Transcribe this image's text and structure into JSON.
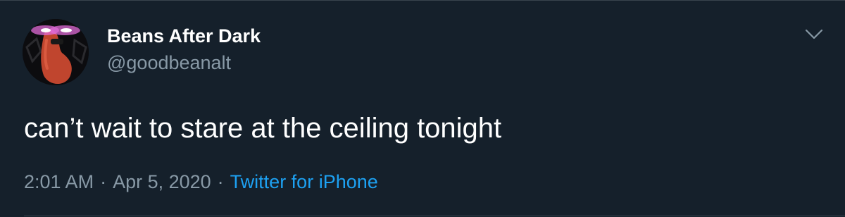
{
  "tweet": {
    "display_name": "Beans After Dark",
    "handle": "@goodbeanalt",
    "text": "can’t wait to stare at the ceiling tonight",
    "time": "2:01 AM",
    "separator": "·",
    "date": "Apr 5, 2020",
    "source": "Twitter for iPhone"
  },
  "icons": {
    "avatar": "bean-avatar-icon",
    "menu": "chevron-down-icon"
  },
  "colors": {
    "background": "#15202b",
    "primary_text": "#ffffff",
    "secondary_text": "#8899a6",
    "link": "#1da1f2",
    "border": "#38444d"
  }
}
